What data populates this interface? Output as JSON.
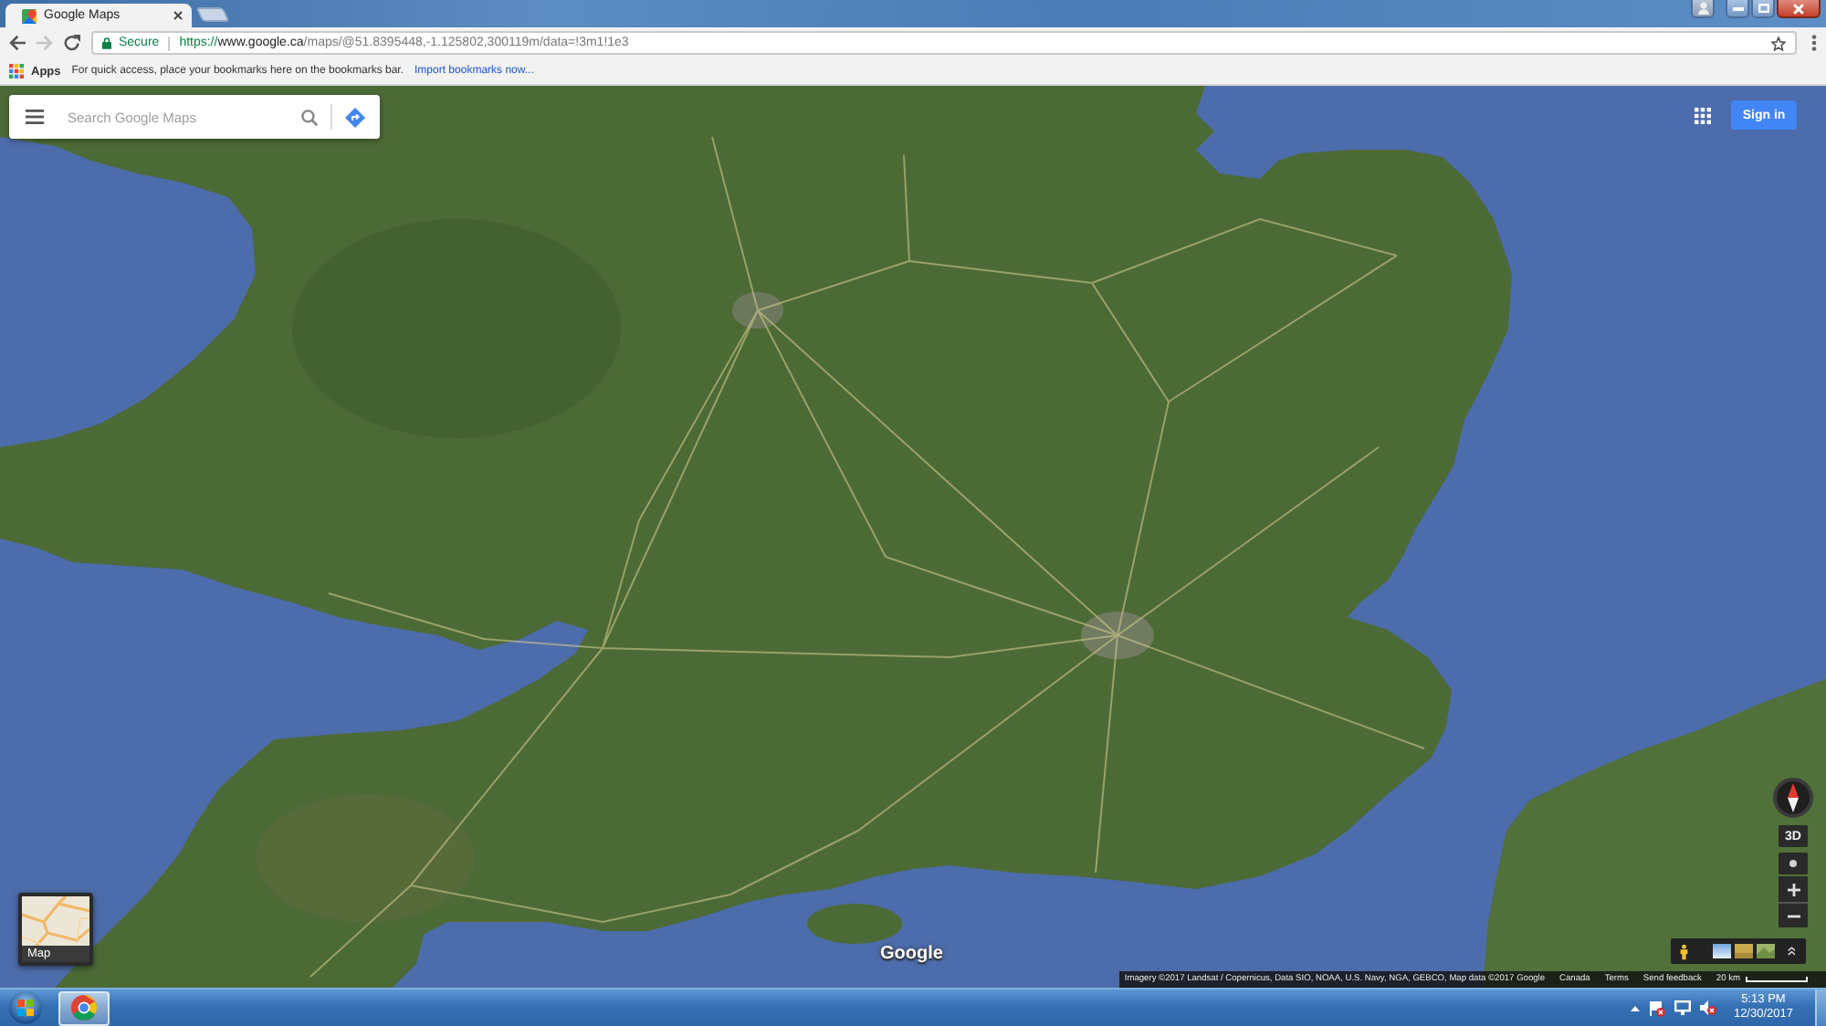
{
  "browser": {
    "tabs": [
      {
        "title": "Google Maps",
        "selected": true
      }
    ],
    "navigation": {
      "back": {
        "disabled": false
      },
      "forward": {
        "disabled": true
      }
    },
    "address_bar": {
      "security": "Secure",
      "url": {
        "scheme": "https://",
        "host": "www.google.ca",
        "path": "/maps/@51.8395448,-1.125802,300119m/data=!3m1!1e3"
      }
    },
    "bookmarks_bar": {
      "apps": "Apps",
      "hint": "For quick access, place your bookmarks here on the bookmarks bar.",
      "import_link": "Import bookmarks now..."
    }
  },
  "maps": {
    "search": {
      "placeholder": "Search Google Maps"
    },
    "sign_in": "Sign in",
    "layer_switch": {
      "label": "Map"
    },
    "logo": "Google",
    "controls": {
      "tilt": "3D"
    },
    "attribution": {
      "credits": "Imagery ©2017 Landsat / Copernicus, Data SIO, NOAA, U.S. Navy, NGA, GEBCO, Map data ©2017 Google",
      "links": [
        "Canada",
        "Terms",
        "Send feedback"
      ],
      "scale": "20 km"
    }
  },
  "taskbar": {
    "time": "5:13 PM",
    "date": "12/30/2017"
  }
}
